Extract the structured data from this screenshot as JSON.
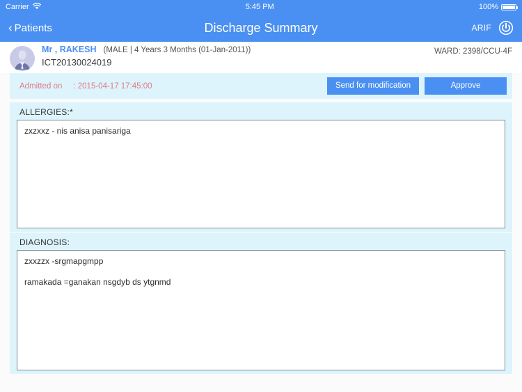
{
  "status_bar": {
    "carrier": "Carrier",
    "wifi_icon": "wifi-icon",
    "time": "5:45 PM",
    "battery_percent": "100%",
    "battery_icon": "battery-full-icon"
  },
  "nav_bar": {
    "back_icon": "chevron-left-icon",
    "back_label": "Patients",
    "title": "Discharge Summary",
    "user": "ARIF",
    "power_icon": "power-icon"
  },
  "patient": {
    "avatar_icon": "user-avatar-icon",
    "name": "Mr , RAKESH",
    "meta": "(MALE | 4 Years 3 Months (01-Jan-2011))",
    "id": "ICT20130024019",
    "ward": "WARD: 2398/CCU-4F"
  },
  "admitted": {
    "label": "Admitted on",
    "value": ": 2015-04-17 17:45:00",
    "send_for_modification_label": "Send for modification",
    "approve_label": "Approve"
  },
  "sections": {
    "allergies": {
      "label": "ALLERGIES:*",
      "lines": [
        "zxzxxz - nis anisa panisariga"
      ]
    },
    "diagnosis": {
      "label": "DIAGNOSIS:",
      "lines": [
        "zxxzzx -srgmapgmpp",
        "ramakada =ganakan nsgdyb ds ytgnmd"
      ]
    }
  },
  "colors": {
    "brand_blue": "#4a90f2",
    "card_blue": "#ddf4fc",
    "admitted_text": "#e07a8a",
    "field_border": "#7c8a8f",
    "avatar_bg": "#c8cbe8"
  }
}
